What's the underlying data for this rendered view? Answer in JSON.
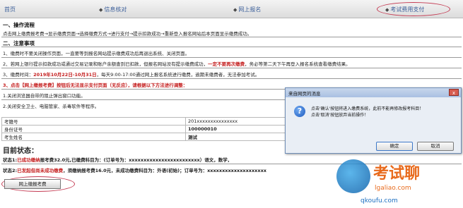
{
  "nav": {
    "home": "首页",
    "info": "信息核对",
    "signup": "网上报名",
    "pay": "考试费用支付"
  },
  "process": {
    "title": "一、操作流程",
    "text": "点击网上缴费报考费→显示缴费页面→选择缴费方式→进行支付→提示扣款成功→重新登入报名网站后本页面显示缴费成功。"
  },
  "notes": {
    "title": "二、注意事项",
    "n1": "1、缴费时不要关闭操作页面，一直要等到报名网站提示缴费成功后再退出系统、关闭页面。",
    "n2_a": "2、若网上银行提示扣款成功或通过交易记录和账户余额查到已扣款，但报名网站没有提示缴费成功，",
    "n2_red": "一定不要再次缴费",
    "n2_b": "，务必等第二天下午再登入报名系统查看缴费结果。",
    "n3_a": "3、缴费时间：",
    "n3_red": "2019年10月22日-10月31日",
    "n3_b": "，每天9:00-17:00通过网上报名系统进行缴费，逾期未缴费者，无法参加考试。",
    "n4_red": "3、点击【网上缴报考费】按钮后无法显示支付页面（无反应），请根据以下方法进行调整：",
    "m1": "1.关闭浏览器自带的阻止弹出窗口功能。",
    "m2": "2.关闭安全卫士、电脑管家、杀毒软件等程序。"
  },
  "table": {
    "rows": [
      {
        "label": "考籍号",
        "value": "201xxxxxxxxxxxxxxx"
      },
      {
        "label": "身份证号",
        "value": "100000010"
      },
      {
        "label": "考生姓名",
        "value": "测试"
      }
    ]
  },
  "status": {
    "title": "目前状态：",
    "s1_label": "状态1:",
    "s1_red": "已成功缴纳",
    "s1_text": "报考费32.0元,已缴费科目为：(订单号为：xxxxxxxxxxxxxxxxxxxxxxxx）语文，数学，",
    "s2_label": "状态2:",
    "s2_red": "已发起但尚未成功缴费",
    "s2_text": "，须缴纳报考费16.0元，未成功缴费科目为：外语(初始)；订单号为：xxxxxxxxxxxxxxxxxxxx"
  },
  "bottom_button": "网上缴报考费",
  "dialog": {
    "title": "来自网页的消息",
    "close": "x",
    "icon": "?",
    "msg1": "点击'确认'按钮将进入缴费系统，此前不能再修改报考科目！",
    "msg2": "点击'取消'按钮放弃当前操作！",
    "ok": "确定",
    "cancel": "取消"
  },
  "watermark": {
    "brand": "考试聊",
    "url1": "lgaliao.com",
    "url2": "qkoufu.com"
  }
}
